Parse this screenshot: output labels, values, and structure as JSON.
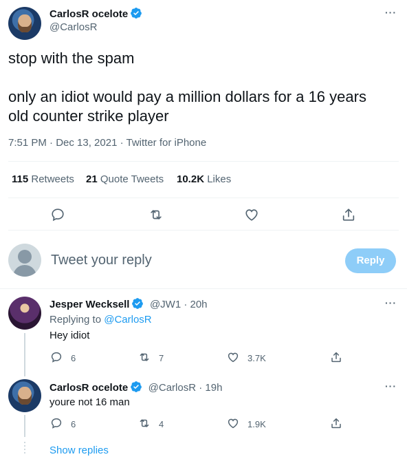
{
  "main_tweet": {
    "author_name": "CarlosR ocelote",
    "author_handle": "@CarlosR",
    "text_line1": "stop with the spam",
    "text_line2": "only an idiot would pay a million dollars for a 16 years",
    "text_line3": "old counter strike player",
    "meta": "7:51 PM · Dec 13, 2021 · Twitter for iPhone",
    "stats": {
      "retweets_count": "115",
      "retweets_label": "Retweets",
      "quotes_count": "21",
      "quotes_label": "Quote Tweets",
      "likes_count": "10.2K",
      "likes_label": "Likes"
    }
  },
  "composer": {
    "placeholder": "Tweet your reply",
    "button_label": "Reply"
  },
  "replies": [
    {
      "author_name": "Jesper Wecksell",
      "handle_time": "@JW1 · 20h",
      "replying_prefix": "Replying to",
      "replying_to": "@CarlosR",
      "text": "Hey idiot",
      "replies": "6",
      "retweets": "7",
      "likes": "3.7K"
    },
    {
      "author_name": "CarlosR ocelote",
      "handle_time": "@CarlosR · 19h",
      "text": "youre not 16 man",
      "replies": "6",
      "retweets": "4",
      "likes": "1.9K"
    }
  ],
  "show_replies_label": "Show replies",
  "more_label": "···",
  "colors": {
    "accent": "#1d9bf0",
    "reply_button_disabled": "#8ecdf8",
    "text_secondary": "#536471",
    "divider": "#eff3f4"
  },
  "icons": [
    "verified-badge-icon",
    "comment-icon",
    "retweet-icon",
    "heart-icon",
    "share-icon",
    "more-icon"
  ]
}
